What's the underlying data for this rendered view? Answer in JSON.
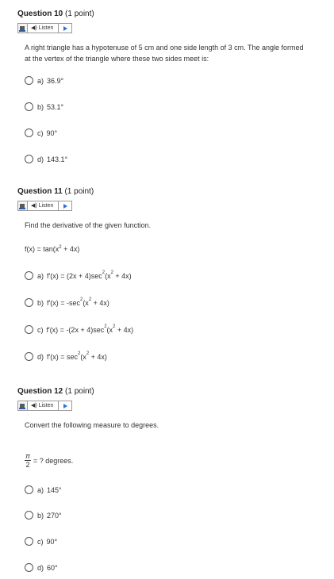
{
  "questions": [
    {
      "title": "Question 10",
      "points": "(1 point)",
      "listen_label": "Listen",
      "text": "A right triangle has a hypotenuse of 5 cm and one side length of 3 cm.  The angle formed at the vertex of the triangle where these two sides meet is:",
      "options": [
        {
          "letter": "a)",
          "text": "36.9°"
        },
        {
          "letter": "b)",
          "text": "53.1°"
        },
        {
          "letter": "c)",
          "text": "90°"
        },
        {
          "letter": "d)",
          "text": "143.1°"
        }
      ]
    },
    {
      "title": "Question 11",
      "points": "(1 point)",
      "listen_label": "Listen",
      "text": "Find the derivative of the given function.",
      "function": "f(x) = tan(x² + 4x)",
      "options": [
        {
          "letter": "a)",
          "text": "f′(x) = (2x + 4)sec²(x² + 4x)"
        },
        {
          "letter": "b)",
          "text": "f′(x) = -sec²(x² + 4x)"
        },
        {
          "letter": "c)",
          "text": "f′(x) = -(2x + 4)sec²(x² + 4x)"
        },
        {
          "letter": "d)",
          "text": "f′(x) = sec²(x² + 4x)"
        }
      ]
    },
    {
      "title": "Question 12",
      "points": "(1 point)",
      "listen_label": "Listen",
      "text": "Convert the following measure to degrees.",
      "expr_num": "π",
      "expr_den": "2",
      "expr_rest": "= ? degrees.",
      "options": [
        {
          "letter": "a)",
          "text": "145°"
        },
        {
          "letter": "b)",
          "text": "270°"
        },
        {
          "letter": "c)",
          "text": "90°"
        },
        {
          "letter": "d)",
          "text": "60°"
        }
      ]
    }
  ],
  "icons": {
    "speaker": "speaker-icon",
    "play": "play-icon",
    "readspeaker": "readspeaker-icon"
  },
  "colors": {
    "play_accent": "#2e6fd8",
    "border": "#9a9a9a"
  }
}
